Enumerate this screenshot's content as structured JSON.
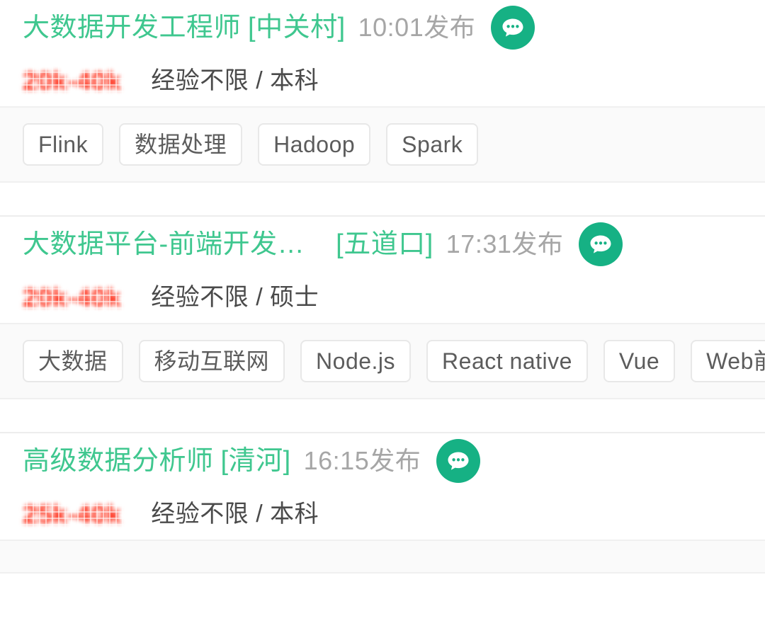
{
  "theme": {
    "brand_green": "#16b184",
    "title_green": "#3fc78f",
    "salary_red": "#ff5a36",
    "time_gray": "#a6a6a6",
    "meta_gray": "#4a4a4a",
    "tag_strip_bg": "#fafafa",
    "page_bg": "#ffffff"
  },
  "jobs": [
    {
      "title": "大数据开发工程师",
      "district": "[中关村]",
      "time": "10:01发布",
      "salary": "20k-40k",
      "salary_obscured": true,
      "meta": "经验不限 / 本科",
      "chat_icon": "chat-bubble-icon",
      "tags": [
        "Flink",
        "数据处理",
        "Hadoop",
        "Spark"
      ]
    },
    {
      "title": "大数据平台-前端开发…",
      "district": "[五道口]",
      "time": "17:31发布",
      "salary": "20k-40k",
      "salary_obscured": true,
      "meta": "经验不限 / 硕士",
      "chat_icon": "chat-bubble-icon",
      "tags": [
        "大数据",
        "移动互联网",
        "Node.js",
        "React native",
        "Vue",
        "Web前端"
      ]
    },
    {
      "title": "高级数据分析师",
      "district": "[清河]",
      "time": "16:15发布",
      "salary": "25k-40k",
      "salary_obscured": true,
      "meta": "经验不限 / 本科",
      "chat_icon": "chat-bubble-icon",
      "tags": []
    }
  ]
}
